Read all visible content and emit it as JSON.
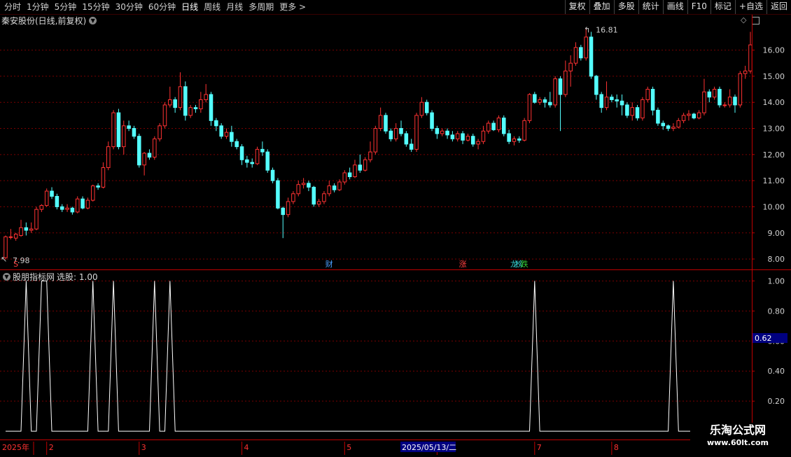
{
  "toolbar": {
    "periods": [
      "分时",
      "1分钟",
      "5分钟",
      "15分钟",
      "30分钟",
      "60分钟",
      "日线",
      "周线",
      "月线",
      "多周期",
      "更多 >"
    ],
    "active_period": "日线",
    "buttons": [
      "复权",
      "叠加",
      "多股",
      "统计",
      "画线",
      "F10",
      "标记",
      "+自选",
      "返回"
    ]
  },
  "chart_header": {
    "title": "秦安股份(日线,前复权)",
    "icons": [
      "diamond-icon",
      "layout-icon"
    ]
  },
  "indicator": {
    "name": "股朋指标网",
    "label": "选股: 1.00"
  },
  "annotations": {
    "high_label": "16.81",
    "low_label": "7.98",
    "events": [
      {
        "text": "S",
        "color": "#ff4040",
        "index": 2
      },
      {
        "text": "财",
        "color": "#4aa0ff",
        "index": 63
      },
      {
        "text": "涨",
        "color": "#ff4040",
        "index": 89
      },
      {
        "text": "龙",
        "color": "#33cccc",
        "index": 99
      },
      {
        "text": "榜",
        "color": "#33cccc",
        "index": 100
      },
      {
        "text": "跌",
        "color": "#33cc33",
        "index": 101
      }
    ]
  },
  "dates": {
    "year_label": "2025年",
    "selected": "2025/05/13/二",
    "months": [
      {
        "label": "2",
        "index": 8
      },
      {
        "label": "3",
        "index": 26
      },
      {
        "label": "4",
        "index": 46
      },
      {
        "label": "5",
        "index": 66
      },
      {
        "label": "6",
        "index": 84
      },
      {
        "label": "7",
        "index": 103
      },
      {
        "label": "8",
        "index": 118
      }
    ]
  },
  "colors": {
    "up": "#ff3232",
    "down": "#54ffff",
    "axis": "#c00000",
    "grid": "#7a0000",
    "line": "#ffffff",
    "selection": "#000080"
  },
  "watermark": {
    "title": "乐淘公式网",
    "url": "www.60lt.com"
  },
  "chart_data": [
    {
      "type": "candlestick",
      "name": "秦安股份",
      "yticks": [
        "16.00",
        "15.00",
        "14.00",
        "13.00",
        "12.00",
        "11.00",
        "10.00",
        "9.00",
        "8.00"
      ],
      "ylim": [
        7.6,
        16.9
      ],
      "candles": [
        [
          8.05,
          8.85,
          7.98,
          8.9
        ],
        [
          8.85,
          8.85,
          8.75,
          9.15
        ],
        [
          8.8,
          8.95,
          8.7,
          9.0
        ],
        [
          8.9,
          9.2,
          8.85,
          9.5
        ],
        [
          9.2,
          9.1,
          8.9,
          9.4
        ],
        [
          9.1,
          9.15,
          9.0,
          9.4
        ],
        [
          9.15,
          9.9,
          9.1,
          10.0
        ],
        [
          9.9,
          10.05,
          9.8,
          10.1
        ],
        [
          10.05,
          10.6,
          10.0,
          10.7
        ],
        [
          10.6,
          10.4,
          10.3,
          10.75
        ],
        [
          10.4,
          10.0,
          9.9,
          10.5
        ],
        [
          10.0,
          9.9,
          9.8,
          10.1
        ],
        [
          9.9,
          9.95,
          9.8,
          10.1
        ],
        [
          9.95,
          9.8,
          9.7,
          10.0
        ],
        [
          9.8,
          10.3,
          9.75,
          10.4
        ],
        [
          10.3,
          9.95,
          9.9,
          10.4
        ],
        [
          9.95,
          10.25,
          9.9,
          10.35
        ],
        [
          10.25,
          10.8,
          10.2,
          10.85
        ],
        [
          10.8,
          10.75,
          10.65,
          10.9
        ],
        [
          10.75,
          11.5,
          10.7,
          11.7
        ],
        [
          11.5,
          12.3,
          11.4,
          12.5
        ],
        [
          12.3,
          13.6,
          12.2,
          13.7
        ],
        [
          13.6,
          12.3,
          12.2,
          13.75
        ],
        [
          12.3,
          13.1,
          12.0,
          13.3
        ],
        [
          13.1,
          13.0,
          12.9,
          13.3
        ],
        [
          13.0,
          12.7,
          12.6,
          13.1
        ],
        [
          12.7,
          11.6,
          11.5,
          12.8
        ],
        [
          11.6,
          12.05,
          11.2,
          12.1
        ],
        [
          12.05,
          11.9,
          11.8,
          12.2
        ],
        [
          11.9,
          12.6,
          11.8,
          12.7
        ],
        [
          12.6,
          13.1,
          12.5,
          13.2
        ],
        [
          13.1,
          13.9,
          13.0,
          14.0
        ],
        [
          13.9,
          14.1,
          13.8,
          14.6
        ],
        [
          14.1,
          13.8,
          13.6,
          14.2
        ],
        [
          13.8,
          14.6,
          13.7,
          15.15
        ],
        [
          14.6,
          13.5,
          13.3,
          14.8
        ],
        [
          13.5,
          13.8,
          13.4,
          13.9
        ],
        [
          13.8,
          13.75,
          13.6,
          13.9
        ],
        [
          13.75,
          14.1,
          13.6,
          14.4
        ],
        [
          14.1,
          14.3,
          14.0,
          14.7
        ],
        [
          14.3,
          13.3,
          13.1,
          14.4
        ],
        [
          13.3,
          13.1,
          12.9,
          13.4
        ],
        [
          13.1,
          12.7,
          12.6,
          13.2
        ],
        [
          12.7,
          12.85,
          12.6,
          13.0
        ],
        [
          12.85,
          12.5,
          12.3,
          13.1
        ],
        [
          12.5,
          12.3,
          12.2,
          12.6
        ],
        [
          12.3,
          11.8,
          11.6,
          12.4
        ],
        [
          11.8,
          11.7,
          11.5,
          11.95
        ],
        [
          11.7,
          11.65,
          11.5,
          11.85
        ],
        [
          11.65,
          12.2,
          11.6,
          12.3
        ],
        [
          12.2,
          12.1,
          11.95,
          12.5
        ],
        [
          12.1,
          11.4,
          11.3,
          12.2
        ],
        [
          11.4,
          11.0,
          10.9,
          11.5
        ],
        [
          11.0,
          9.95,
          9.9,
          11.1
        ],
        [
          9.95,
          9.7,
          8.8,
          10.0
        ],
        [
          9.7,
          10.2,
          9.6,
          10.35
        ],
        [
          10.2,
          10.5,
          10.1,
          10.6
        ],
        [
          10.5,
          10.85,
          10.4,
          11.0
        ],
        [
          10.85,
          10.9,
          10.7,
          11.1
        ],
        [
          10.9,
          10.75,
          10.6,
          11.0
        ],
        [
          10.75,
          10.1,
          10.0,
          10.8
        ],
        [
          10.1,
          10.2,
          10.0,
          10.3
        ],
        [
          10.2,
          10.5,
          10.1,
          10.6
        ],
        [
          10.5,
          10.8,
          10.4,
          11.0
        ],
        [
          10.8,
          10.65,
          10.55,
          10.9
        ],
        [
          10.65,
          10.95,
          10.6,
          11.05
        ],
        [
          10.95,
          11.3,
          10.85,
          11.4
        ],
        [
          11.3,
          11.15,
          11.05,
          11.5
        ],
        [
          11.15,
          11.6,
          11.1,
          11.8
        ],
        [
          11.6,
          11.4,
          11.3,
          12.0
        ],
        [
          11.4,
          11.8,
          11.35,
          11.9
        ],
        [
          11.8,
          12.1,
          11.7,
          12.5
        ],
        [
          12.1,
          13.0,
          12.0,
          13.1
        ],
        [
          13.0,
          13.5,
          12.9,
          13.8
        ],
        [
          13.5,
          12.9,
          12.8,
          13.6
        ],
        [
          12.9,
          12.6,
          12.5,
          13.0
        ],
        [
          12.6,
          13.0,
          12.5,
          13.2
        ],
        [
          13.0,
          12.8,
          12.7,
          13.3
        ],
        [
          12.8,
          12.4,
          12.3,
          12.9
        ],
        [
          12.4,
          12.2,
          12.1,
          12.6
        ],
        [
          12.2,
          13.5,
          12.1,
          13.6
        ],
        [
          13.5,
          14.0,
          13.4,
          14.2
        ],
        [
          14.0,
          13.6,
          13.5,
          14.1
        ],
        [
          13.6,
          13.0,
          12.9,
          13.7
        ],
        [
          13.0,
          12.8,
          12.6,
          13.1
        ],
        [
          12.8,
          12.9,
          12.7,
          13.0
        ],
        [
          12.9,
          12.75,
          12.6,
          13.0
        ],
        [
          12.75,
          12.6,
          12.5,
          12.9
        ],
        [
          12.6,
          12.8,
          12.5,
          12.9
        ],
        [
          12.8,
          12.55,
          12.4,
          12.9
        ],
        [
          12.55,
          12.7,
          12.5,
          12.8
        ],
        [
          12.7,
          12.4,
          12.3,
          12.8
        ],
        [
          12.4,
          12.5,
          12.2,
          12.6
        ],
        [
          12.5,
          12.9,
          12.4,
          13.1
        ],
        [
          12.9,
          13.2,
          12.8,
          13.3
        ],
        [
          13.2,
          12.95,
          12.9,
          13.3
        ],
        [
          12.95,
          13.4,
          12.85,
          13.5
        ],
        [
          13.4,
          12.8,
          12.7,
          13.5
        ],
        [
          12.8,
          12.5,
          12.4,
          12.95
        ],
        [
          12.5,
          12.6,
          12.35,
          12.7
        ],
        [
          12.6,
          12.55,
          12.45,
          12.7
        ],
        [
          12.55,
          13.3,
          12.5,
          13.4
        ],
        [
          13.3,
          14.3,
          13.2,
          14.35
        ],
        [
          14.3,
          14.0,
          13.95,
          14.4
        ],
        [
          14.0,
          14.1,
          13.9,
          14.2
        ],
        [
          14.1,
          14.0,
          13.8,
          14.2
        ],
        [
          14.0,
          13.9,
          13.8,
          14.4
        ],
        [
          13.9,
          14.9,
          13.8,
          15.0
        ],
        [
          14.9,
          14.3,
          12.9,
          15.0
        ],
        [
          14.3,
          15.2,
          14.2,
          15.6
        ],
        [
          15.2,
          15.5,
          14.6,
          15.8
        ],
        [
          15.5,
          16.1,
          15.4,
          16.3
        ],
        [
          16.1,
          15.7,
          15.6,
          16.2
        ],
        [
          15.7,
          16.5,
          15.6,
          16.81
        ],
        [
          16.5,
          15.0,
          14.9,
          16.7
        ],
        [
          15.0,
          14.3,
          14.1,
          15.05
        ],
        [
          14.3,
          13.8,
          13.6,
          14.4
        ],
        [
          13.8,
          14.2,
          13.7,
          14.8
        ],
        [
          14.2,
          14.1,
          14.0,
          14.3
        ],
        [
          14.1,
          14.05,
          13.8,
          14.3
        ],
        [
          14.05,
          13.9,
          13.5,
          14.3
        ],
        [
          13.9,
          13.5,
          13.4,
          14.0
        ],
        [
          13.5,
          13.8,
          13.3,
          14.0
        ],
        [
          13.8,
          13.4,
          13.3,
          13.9
        ],
        [
          13.4,
          14.1,
          13.3,
          14.2
        ],
        [
          14.1,
          14.5,
          14.0,
          14.6
        ],
        [
          14.5,
          13.7,
          13.5,
          14.6
        ],
        [
          13.7,
          13.2,
          13.1,
          13.8
        ],
        [
          13.2,
          13.1,
          12.95,
          13.3
        ],
        [
          13.1,
          13.0,
          12.9,
          13.15
        ],
        [
          13.0,
          13.05,
          12.9,
          13.2
        ],
        [
          13.05,
          13.3,
          13.0,
          13.4
        ],
        [
          13.3,
          13.5,
          13.2,
          13.6
        ],
        [
          13.5,
          13.55,
          13.3,
          13.7
        ],
        [
          13.55,
          13.4,
          13.35,
          13.6
        ],
        [
          13.4,
          13.6,
          13.35,
          13.7
        ],
        [
          13.6,
          14.4,
          13.5,
          14.9
        ],
        [
          14.4,
          14.2,
          14.0,
          14.5
        ],
        [
          14.2,
          14.5,
          14.1,
          14.6
        ],
        [
          14.5,
          13.9,
          13.8,
          14.6
        ],
        [
          13.9,
          13.9,
          13.8,
          14.0
        ],
        [
          13.9,
          14.2,
          13.8,
          14.5
        ],
        [
          14.2,
          13.9,
          13.6,
          14.3
        ],
        [
          13.9,
          15.1,
          13.8,
          15.2
        ],
        [
          15.1,
          15.2,
          14.9,
          15.4
        ],
        [
          15.2,
          16.2,
          15.1,
          16.7
        ]
      ]
    },
    {
      "type": "line",
      "name": "选股",
      "yticks": [
        "1.00",
        "0.80",
        "0.60",
        "0.40",
        "0.20"
      ],
      "ylim": [
        -0.06,
        1.03
      ],
      "current_value": "0.62",
      "signals": [
        4,
        7,
        8,
        17,
        21,
        29,
        32,
        103,
        130
      ]
    }
  ]
}
